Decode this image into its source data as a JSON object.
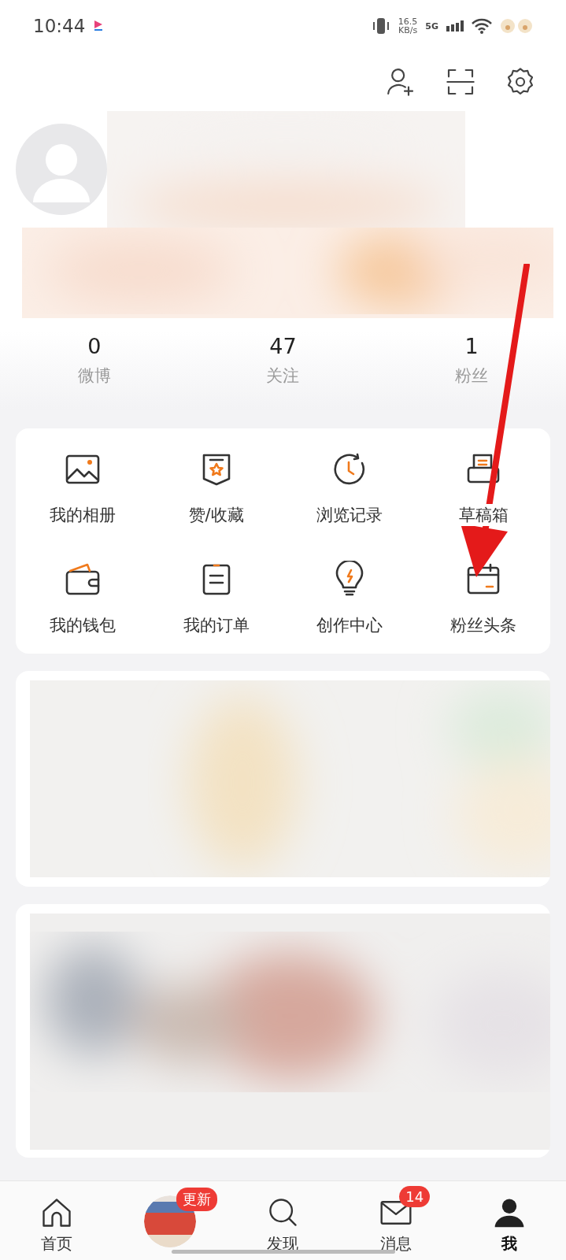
{
  "status_bar": {
    "time": "10:44",
    "speed": "16.5",
    "speed_unit": "KB/s",
    "network": "5G"
  },
  "stats": [
    {
      "value": "0",
      "label": "微博"
    },
    {
      "value": "47",
      "label": "关注"
    },
    {
      "value": "1",
      "label": "粉丝"
    }
  ],
  "menu": [
    {
      "label": "我的相册"
    },
    {
      "label": "赞/收藏"
    },
    {
      "label": "浏览记录"
    },
    {
      "label": "草稿箱"
    },
    {
      "label": "我的钱包"
    },
    {
      "label": "我的订单"
    },
    {
      "label": "创作中心"
    },
    {
      "label": "粉丝头条"
    }
  ],
  "tabs": [
    {
      "kind": "icon",
      "label": "首页",
      "selected": false
    },
    {
      "kind": "avatar",
      "badge": "更新",
      "selected": false
    },
    {
      "kind": "icon",
      "label": "发现",
      "selected": false
    },
    {
      "kind": "icon",
      "label": "消息",
      "badge": "14",
      "selected": false
    },
    {
      "kind": "icon",
      "label": "我",
      "selected": true
    }
  ]
}
